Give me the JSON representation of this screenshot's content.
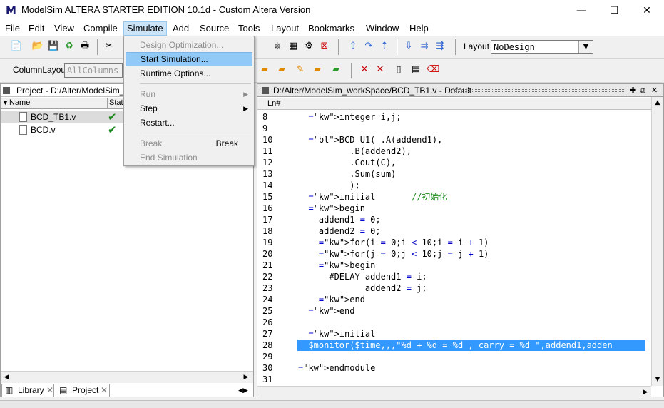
{
  "window": {
    "title": "ModelSim ALTERA STARTER EDITION 10.1d - Custom Altera Version",
    "logo": "M",
    "controls": {
      "minimize": "—",
      "maximize": "☐",
      "close": "✕"
    }
  },
  "menubar": {
    "items": [
      "File",
      "Edit",
      "View",
      "Compile",
      "Simulate",
      "Add",
      "Source",
      "Tools",
      "Layout",
      "Bookmarks",
      "Window",
      "Help"
    ],
    "active": "Simulate"
  },
  "simulate_menu": {
    "items": [
      {
        "label": "Design Optimization...",
        "enabled": false
      },
      {
        "label": "Start Simulation...",
        "enabled": true,
        "highlighted": true
      },
      {
        "label": "Runtime Options...",
        "enabled": true
      },
      {
        "label": "Run",
        "enabled": false,
        "submenu": true
      },
      {
        "label": "Step",
        "enabled": true,
        "submenu": true
      },
      {
        "label": "Restart...",
        "enabled": true
      },
      {
        "label": "Break",
        "enabled": false,
        "accelerator": "Break"
      },
      {
        "label": "End Simulation",
        "enabled": false
      }
    ]
  },
  "toolbar": {
    "layout_label": "Layout",
    "layout_value": "NoDesign",
    "column_layout_label": "ColumnLayout",
    "column_layout_value": "AllColumns"
  },
  "project_pane": {
    "title": "Project - D:/Alter/ModelSim_wor",
    "columns": [
      "Name",
      "Stat"
    ],
    "files": [
      {
        "name": "BCD_TB1.v",
        "status": "✔",
        "selected": true
      },
      {
        "name": "BCD.v",
        "status": "✔",
        "selected": false
      }
    ]
  },
  "bottom_tabs": [
    {
      "label": "Library",
      "active": false
    },
    {
      "label": "Project",
      "active": true
    }
  ],
  "source_pane": {
    "title": "D:/Alter/ModelSim_workSpace/BCD_TB1.v - Default",
    "column_header": "Ln#",
    "highlighted_line": 28,
    "lines": [
      {
        "n": "8",
        "text": "  integer i,j;"
      },
      {
        "n": "9",
        "text": ""
      },
      {
        "n": "10",
        "text": "  BCD U1( .A(addend1),"
      },
      {
        "n": "11",
        "text": "          .B(addend2),"
      },
      {
        "n": "12",
        "text": "          .Cout(C),"
      },
      {
        "n": "13",
        "text": "          .Sum(sum)"
      },
      {
        "n": "14",
        "text": "          );"
      },
      {
        "n": "15",
        "text": "  initial       //初始化"
      },
      {
        "n": "16",
        "text": "  begin"
      },
      {
        "n": "17",
        "text": "    addend1 = 0;"
      },
      {
        "n": "18",
        "text": "    addend2 = 0;"
      },
      {
        "n": "19",
        "text": "    for(i = 0;i < 10;i = i + 1)"
      },
      {
        "n": "20",
        "text": "    for(j = 0;j < 10;j = j + 1)"
      },
      {
        "n": "21",
        "text": "    begin"
      },
      {
        "n": "22",
        "text": "      #DELAY addend1 = i;"
      },
      {
        "n": "23",
        "text": "             addend2 = j;"
      },
      {
        "n": "24",
        "text": "    end"
      },
      {
        "n": "25",
        "text": "  end"
      },
      {
        "n": "26",
        "text": ""
      },
      {
        "n": "27",
        "text": "  initial"
      },
      {
        "n": "28",
        "text": "  $monitor($time,,,\"%d + %d = %d , carry = %d \",addend1,adden"
      },
      {
        "n": "29",
        "text": ""
      },
      {
        "n": "30",
        "text": "endmodule"
      },
      {
        "n": "31",
        "text": ""
      }
    ]
  },
  "colors": {
    "keyword": "#d5007f",
    "identifier_blue": "#0000cc",
    "comment": "#1a8a1a",
    "highlight": "#3399ff",
    "menu_hover": "#91c9f7"
  }
}
